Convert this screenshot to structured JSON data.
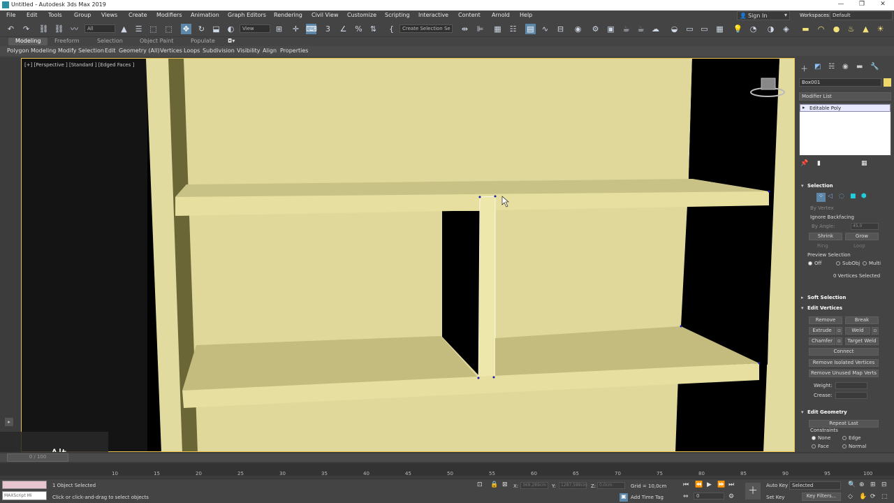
{
  "window": {
    "title": "Untitled - Autodesk 3ds Max 2019"
  },
  "menubar": {
    "items": [
      "File",
      "Edit",
      "Tools",
      "Group",
      "Views",
      "Create",
      "Modifiers",
      "Animation",
      "Graph Editors",
      "Rendering",
      "Civil View",
      "Customize",
      "Scripting",
      "Interactive",
      "Content",
      "Arnold",
      "Help"
    ],
    "sign_in": "Sign In",
    "workspaces_label": "Workspaces:",
    "workspaces_value": "Default"
  },
  "toolbar": {
    "filter_value": "All",
    "coord_value": "View",
    "selection_set_placeholder": "Create Selection Se"
  },
  "ribbon": {
    "tabs": [
      "Modeling",
      "Freeform",
      "Selection",
      "Object Paint",
      "Populate"
    ],
    "active_tab": "Modeling",
    "subtabs": [
      "Polygon Modeling",
      "Modify Selection",
      "Edit",
      "Geometry (All)",
      "Vertices",
      "Loops",
      "Subdivision",
      "Visibility",
      "Align",
      "Properties"
    ]
  },
  "viewport": {
    "label": "[+] [Perspective ] [Standard ] [Edged Faces ]",
    "mesh_color": "#e0d99a",
    "background": "#000000"
  },
  "command_panel": {
    "object_name": "Box001",
    "object_color": "#f0d76a",
    "modifier_list_label": "Modifier List",
    "stack_item": "Editable Poly",
    "selection": {
      "header": "Selection",
      "by_vertex": "By Vertex",
      "ignore_backfacing": "Ignore Backfacing",
      "by_angle": "By Angle:",
      "by_angle_value": "45,0",
      "shrink": "Shrink",
      "grow": "Grow",
      "ring": "Ring",
      "loop": "Loop",
      "preview_selection": "Preview Selection",
      "preview_options": [
        "Off",
        "SubObj",
        "Multi"
      ],
      "status": "0 Vertices Selected"
    },
    "soft_selection": "Soft Selection",
    "edit_vertices": {
      "header": "Edit Vertices",
      "remove": "Remove",
      "break": "Break",
      "extrude": "Extrude",
      "weld": "Weld",
      "chamfer": "Chamfer",
      "target_weld": "Target Weld",
      "connect": "Connect",
      "remove_isolated": "Remove Isolated Vertices",
      "remove_unused": "Remove Unused Map Verts",
      "weight": "Weight:",
      "crease": "Crease:"
    },
    "edit_geometry": {
      "header": "Edit Geometry",
      "repeat_last": "Repeat Last",
      "constraints": "Constraints",
      "options": [
        "None",
        "Edge",
        "Face",
        "Normal"
      ]
    }
  },
  "overlay": {
    "key_hint": "Alt"
  },
  "timeline": {
    "frame_counter": "0 / 100",
    "ticks": [
      "10",
      "15",
      "20",
      "25",
      "30",
      "35",
      "40",
      "45",
      "50",
      "55",
      "60",
      "65",
      "70",
      "75",
      "80",
      "85",
      "90",
      "95",
      "100"
    ]
  },
  "status": {
    "script_label": "MAXScript Mi",
    "objects_selected": "1 Object Selected",
    "prompt": "Click or click-and-drag to select objects",
    "x_label": "X:",
    "x_value": "369,289cm",
    "y_label": "Y:",
    "y_value": "1287,589cm",
    "z_label": "Z:",
    "z_value": "0,0cm",
    "grid": "Grid = 10,0cm",
    "add_time_tag": "Add Time Tag",
    "frame_value": "0",
    "auto_key": "Auto Key",
    "selected_dropdown": "Selected",
    "set_key": "Set Key",
    "key_filters": "Key Filters..."
  }
}
